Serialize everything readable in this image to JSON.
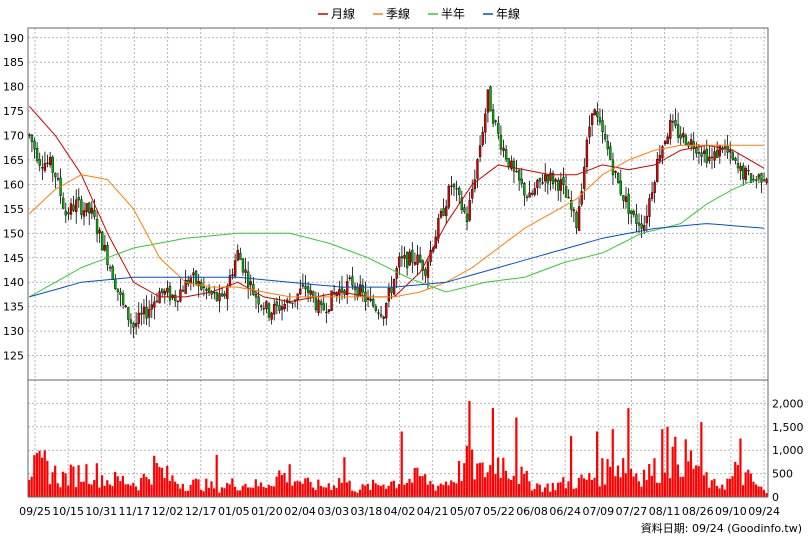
{
  "chart_data": {
    "type": "candlestick_with_volume",
    "legend": [
      {
        "name": "月線",
        "color": "#cc0000"
      },
      {
        "name": "季線",
        "color": "#ff8000"
      },
      {
        "name": "半年",
        "color": "#33cc33"
      },
      {
        "name": "年線",
        "color": "#0050d0"
      }
    ],
    "price_axis": {
      "min": 120,
      "max": 192,
      "ticks": [
        125,
        130,
        135,
        140,
        145,
        150,
        155,
        160,
        165,
        170,
        175,
        180,
        185,
        190
      ]
    },
    "volume_axis": {
      "min": 0,
      "max": 2500,
      "ticks": [
        0,
        500,
        1000,
        1500,
        2000
      ],
      "tick_labels": [
        "0",
        "500",
        "1,000",
        "1,500",
        "2,000"
      ]
    },
    "x_tick_labels": [
      "09/25",
      "10/15",
      "10/31",
      "11/17",
      "12/02",
      "12/17",
      "01/05",
      "01/20",
      "02/04",
      "03/03",
      "03/18",
      "04/02",
      "04/21",
      "05/07",
      "05/22",
      "06/08",
      "06/24",
      "07/09",
      "07/27",
      "08/11",
      "08/26",
      "09/10",
      "09/24"
    ],
    "price_anchors": [
      [
        0,
        170
      ],
      [
        4,
        165
      ],
      [
        8,
        164
      ],
      [
        10,
        162
      ],
      [
        14,
        154
      ],
      [
        18,
        156
      ],
      [
        24,
        154
      ],
      [
        30,
        145
      ],
      [
        36,
        135
      ],
      [
        40,
        131
      ],
      [
        45,
        134
      ],
      [
        50,
        138
      ],
      [
        56,
        137
      ],
      [
        62,
        141
      ],
      [
        68,
        138
      ],
      [
        74,
        136
      ],
      [
        80,
        146
      ],
      [
        86,
        138
      ],
      [
        92,
        134
      ],
      [
        100,
        136
      ],
      [
        106,
        139
      ],
      [
        112,
        134
      ],
      [
        118,
        138
      ],
      [
        124,
        140
      ],
      [
        130,
        136
      ],
      [
        136,
        134
      ],
      [
        142,
        144
      ],
      [
        148,
        145
      ],
      [
        152,
        143
      ],
      [
        156,
        150
      ],
      [
        162,
        160
      ],
      [
        168,
        153
      ],
      [
        172,
        165
      ],
      [
        176,
        178
      ],
      [
        180,
        170
      ],
      [
        186,
        162
      ],
      [
        192,
        157
      ],
      [
        198,
        162
      ],
      [
        204,
        160
      ],
      [
        210,
        152
      ],
      [
        216,
        176
      ],
      [
        222,
        167
      ],
      [
        226,
        160
      ],
      [
        232,
        153
      ],
      [
        236,
        152
      ],
      [
        242,
        167
      ],
      [
        246,
        172
      ],
      [
        250,
        170
      ],
      [
        256,
        168
      ],
      [
        262,
        165
      ],
      [
        266,
        168
      ],
      [
        272,
        163
      ],
      [
        278,
        161
      ],
      [
        282,
        162
      ]
    ],
    "ma_month": [
      [
        0,
        176
      ],
      [
        10,
        170
      ],
      [
        20,
        162
      ],
      [
        30,
        150
      ],
      [
        40,
        140
      ],
      [
        50,
        137
      ],
      [
        60,
        137
      ],
      [
        70,
        138
      ],
      [
        80,
        140
      ],
      [
        90,
        137
      ],
      [
        100,
        136
      ],
      [
        110,
        137
      ],
      [
        120,
        138
      ],
      [
        130,
        137
      ],
      [
        140,
        137
      ],
      [
        150,
        142
      ],
      [
        160,
        152
      ],
      [
        170,
        160
      ],
      [
        180,
        164
      ],
      [
        190,
        163
      ],
      [
        200,
        162
      ],
      [
        210,
        162
      ],
      [
        220,
        164
      ],
      [
        230,
        163
      ],
      [
        240,
        164
      ],
      [
        250,
        167
      ],
      [
        260,
        168
      ],
      [
        270,
        167
      ],
      [
        283,
        163
      ]
    ],
    "ma_quarter": [
      [
        0,
        154
      ],
      [
        10,
        159
      ],
      [
        20,
        162
      ],
      [
        30,
        161
      ],
      [
        40,
        155
      ],
      [
        50,
        145
      ],
      [
        60,
        140
      ],
      [
        70,
        139
      ],
      [
        80,
        139
      ],
      [
        90,
        138
      ],
      [
        100,
        137
      ],
      [
        110,
        137
      ],
      [
        120,
        137
      ],
      [
        130,
        137
      ],
      [
        140,
        137
      ],
      [
        150,
        138
      ],
      [
        160,
        140
      ],
      [
        170,
        143
      ],
      [
        180,
        147
      ],
      [
        190,
        151
      ],
      [
        200,
        154
      ],
      [
        210,
        157
      ],
      [
        220,
        162
      ],
      [
        230,
        165
      ],
      [
        240,
        167
      ],
      [
        250,
        168
      ],
      [
        260,
        168
      ],
      [
        270,
        168
      ],
      [
        283,
        168
      ]
    ],
    "ma_half": [
      [
        0,
        137
      ],
      [
        20,
        143
      ],
      [
        40,
        147
      ],
      [
        60,
        149
      ],
      [
        80,
        150
      ],
      [
        100,
        150
      ],
      [
        115,
        148
      ],
      [
        130,
        145
      ],
      [
        145,
        141
      ],
      [
        160,
        138
      ],
      [
        175,
        140
      ],
      [
        190,
        141
      ],
      [
        205,
        144
      ],
      [
        220,
        146
      ],
      [
        235,
        150
      ],
      [
        250,
        152
      ],
      [
        260,
        156
      ],
      [
        270,
        159
      ],
      [
        283,
        162
      ]
    ],
    "ma_year": [
      [
        0,
        137
      ],
      [
        20,
        140
      ],
      [
        40,
        141
      ],
      [
        60,
        141
      ],
      [
        80,
        141
      ],
      [
        100,
        140
      ],
      [
        120,
        139
      ],
      [
        140,
        139
      ],
      [
        160,
        140
      ],
      [
        180,
        143
      ],
      [
        200,
        146
      ],
      [
        220,
        149
      ],
      [
        240,
        151
      ],
      [
        260,
        152
      ],
      [
        283,
        151
      ]
    ],
    "volume_anchors": [
      [
        0,
        700
      ],
      [
        6,
        850
      ],
      [
        12,
        500
      ],
      [
        18,
        600
      ],
      [
        24,
        700
      ],
      [
        30,
        450
      ],
      [
        36,
        450
      ],
      [
        42,
        350
      ],
      [
        48,
        800
      ],
      [
        54,
        500
      ],
      [
        60,
        350
      ],
      [
        66,
        350
      ],
      [
        72,
        250
      ],
      [
        78,
        350
      ],
      [
        84,
        350
      ],
      [
        90,
        300
      ],
      [
        96,
        600
      ],
      [
        102,
        500
      ],
      [
        108,
        300
      ],
      [
        114,
        300
      ],
      [
        120,
        450
      ],
      [
        126,
        200
      ],
      [
        132,
        300
      ],
      [
        138,
        400
      ],
      [
        144,
        400
      ],
      [
        150,
        550
      ],
      [
        156,
        300
      ],
      [
        162,
        450
      ],
      [
        168,
        900
      ],
      [
        174,
        650
      ],
      [
        180,
        1000
      ],
      [
        186,
        700
      ],
      [
        192,
        400
      ],
      [
        198,
        250
      ],
      [
        204,
        350
      ],
      [
        210,
        400
      ],
      [
        216,
        500
      ],
      [
        222,
        750
      ],
      [
        228,
        900
      ],
      [
        234,
        600
      ],
      [
        240,
        700
      ],
      [
        246,
        1000
      ],
      [
        250,
        1100
      ],
      [
        256,
        850
      ],
      [
        262,
        300
      ],
      [
        268,
        400
      ],
      [
        272,
        600
      ],
      [
        276,
        500
      ],
      [
        283,
        100
      ]
    ],
    "volume_spikes": [
      [
        72,
        900
      ],
      [
        100,
        700
      ],
      [
        121,
        850
      ],
      [
        143,
        1400
      ],
      [
        169,
        2050
      ],
      [
        178,
        1900
      ],
      [
        187,
        1700
      ],
      [
        208,
        1300
      ],
      [
        218,
        1400
      ],
      [
        224,
        1450
      ],
      [
        230,
        1900
      ],
      [
        243,
        1450
      ],
      [
        245,
        1500
      ],
      [
        258,
        1600
      ],
      [
        271,
        750
      ],
      [
        273,
        1250
      ]
    ]
  },
  "credit": "資料日期: 09/24 (Goodinfo.tw)"
}
